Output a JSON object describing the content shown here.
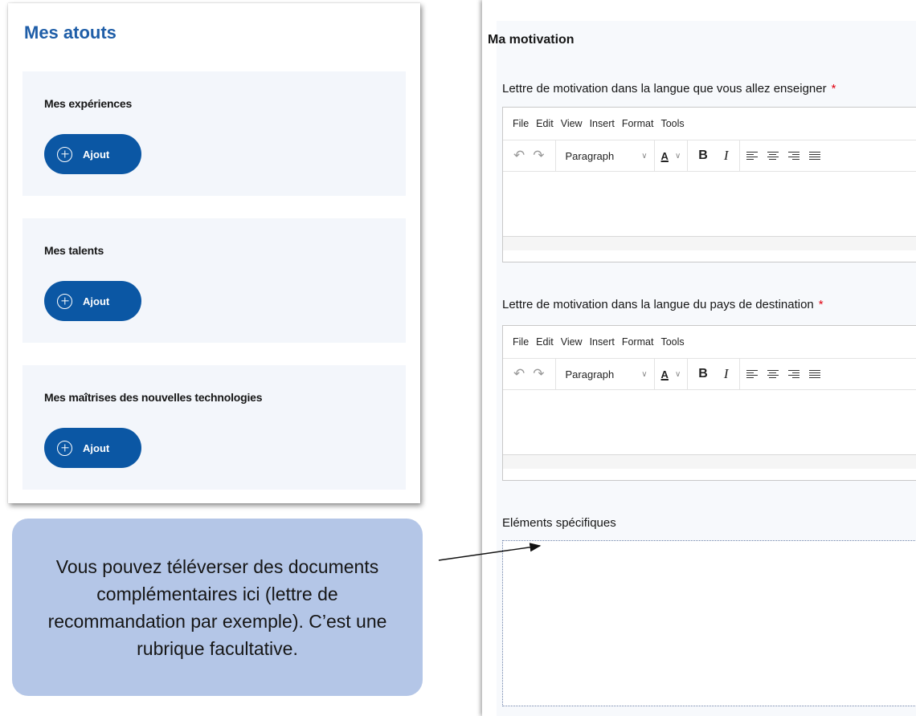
{
  "atouts": {
    "title": "Mes atouts",
    "cards": [
      {
        "title": "Mes expériences",
        "button_label": "Ajout"
      },
      {
        "title": "Mes talents",
        "button_label": "Ajout"
      },
      {
        "title": "Mes maîtrises des nouvelles technologies",
        "button_label": "Ajout"
      }
    ]
  },
  "callout": {
    "text": "Vous pouvez téléverser des documents complémentaires ici (lettre de recommandation par exemple). C’est une rubrique facultative."
  },
  "motivation": {
    "title": "Ma motivation",
    "fields": [
      {
        "label": "Lettre de motivation dans la langue que vous allez enseigner",
        "required_mark": "*"
      },
      {
        "label": "Lettre de motivation dans la langue du pays de destination",
        "required_mark": "*"
      }
    ],
    "editor": {
      "menu": [
        "File",
        "Edit",
        "View",
        "Insert",
        "Format",
        "Tools"
      ],
      "block_format": "Paragraph",
      "text_color_label": "A",
      "bold_label": "B",
      "italic_label": "I"
    },
    "specific": {
      "label": "Eléments spécifiques"
    }
  },
  "icons": [
    "plus-circle-icon",
    "undo-icon",
    "redo-icon",
    "chevron-down-icon",
    "align-left-icon",
    "align-center-icon",
    "align-right-icon",
    "align-justify-icon"
  ],
  "colors": {
    "primary": "#0b57a4",
    "title_blue": "#1f5ea8",
    "card_bg": "#f3f6fb",
    "callout_bg": "#b4c6e7",
    "required": "#e1000f"
  }
}
